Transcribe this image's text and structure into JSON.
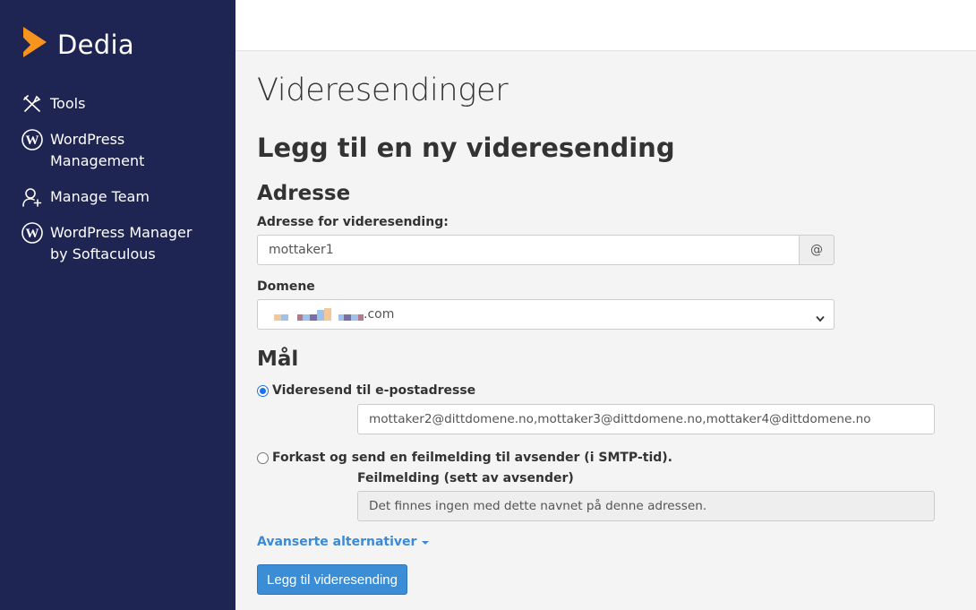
{
  "brand": {
    "name": "Dedia",
    "logo_color": "#f7941d"
  },
  "sidebar": {
    "items": [
      {
        "label": "Tools",
        "icon": "tools-icon"
      },
      {
        "label": "WordPress\nManagement",
        "icon": "wordpress-icon"
      },
      {
        "label": "Manage Team",
        "icon": "user-add-icon"
      },
      {
        "label": "WordPress Manager\nby Softaculous",
        "icon": "wordpress-icon"
      }
    ]
  },
  "page": {
    "title": "Videresendinger",
    "section_title": "Legg til en ny videresending",
    "address_heading": "Adresse",
    "address_label": "Adresse for videresending:",
    "address_value": "mottaker1",
    "address_addon": "@",
    "domain_label": "Domene",
    "domain_suffix": ".com",
    "target_heading": "Mål",
    "radio_forward_label": "Videresend til e-postadresse",
    "radio_forward_checked": true,
    "forward_value": "mottaker2@dittdomene.no,mottaker3@dittdomene.no,mottaker4@dittdomene.no",
    "radio_discard_label": "Forkast og send en feilmelding til avsender (i SMTP-tid).",
    "radio_discard_checked": false,
    "error_label": "Feilmelding (sett av avsender)",
    "error_value": "Det finnes ingen med dette navnet på denne adressen.",
    "advanced_link": "Avanserte alternativer",
    "submit_label": "Legg til videresending"
  },
  "colors": {
    "sidebar_bg": "#1f2553",
    "accent": "#3b8dd6",
    "brand_orange": "#f7941d"
  }
}
